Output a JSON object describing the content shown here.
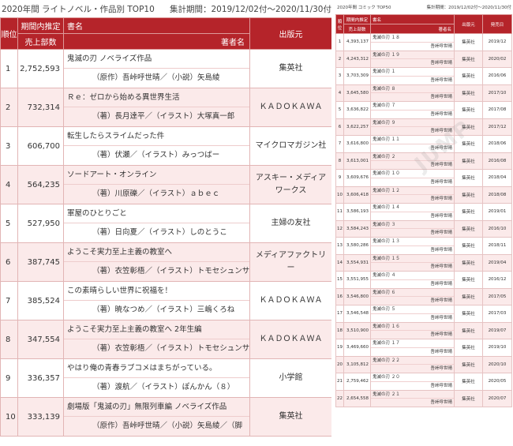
{
  "ln": {
    "title": "2020年間 ライトノベル・作品別 TOP10",
    "period": "集計期間：2019/12/02付〜2020/11/30付",
    "headers": {
      "rank": "順位",
      "sales_1": "期間内推定",
      "sales_2": "売上部数",
      "book": "書名",
      "author": "著者名",
      "publisher": "出版元"
    },
    "rows": [
      {
        "rank": "1",
        "sales": "2,752,593",
        "title": "鬼滅の刃 ノベライズ作品",
        "author": "（原作）吾峠呼世晴／（小説）矢島綾",
        "publisher": "集英社"
      },
      {
        "rank": "2",
        "sales": "732,314",
        "title": "Ｒｅ：ゼロから始める異世界生活",
        "author": "（著）長月達平／（イラスト）大塚真一郎",
        "publisher": "ＫＡＤＯＫＡＷＡ"
      },
      {
        "rank": "3",
        "sales": "606,700",
        "title": "転生したらスライムだった件",
        "author": "（著）伏瀬／（イラスト）みっつばー",
        "publisher": "マイクロマガジン社"
      },
      {
        "rank": "4",
        "sales": "564,235",
        "title": "ソードアート・オンライン",
        "author": "（著）川原礫／（イラスト）ａｂｅｃ",
        "publisher": "アスキー・メディアワークス"
      },
      {
        "rank": "5",
        "sales": "527,950",
        "title": "軍屋のひとりごと",
        "author": "（著）日向夏／（イラスト）しのとうこ",
        "publisher": "主婦の友社"
      },
      {
        "rank": "6",
        "sales": "387,745",
        "title": "ようこそ実力至上主義の教室へ",
        "author": "（著）衣笠彰梧／（イラスト）トモセシュンサク",
        "publisher": "メディアファクトリー"
      },
      {
        "rank": "7",
        "sales": "385,524",
        "title": "この素晴らしい世界に祝福を！",
        "author": "（著）暁なつめ／（イラスト）三嶋くろね",
        "publisher": "ＫＡＤＯＫＡＷＡ"
      },
      {
        "rank": "8",
        "sales": "347,554",
        "title": "ようこそ実力至上主義の教室へ 2年生編",
        "author": "（著）衣笠彰梧／（イラスト）トモセシュンサク",
        "publisher": "ＫＡＤＯＫＡＷＡ"
      },
      {
        "rank": "9",
        "sales": "336,357",
        "title": "やはり俺の青春ラブコメはまちがっている。",
        "author": "（著）渡航／（イラスト）ぽんかん（８）",
        "publisher": "小学館"
      },
      {
        "rank": "10",
        "sales": "333,139",
        "title": "劇場版「鬼滅の刃」無限列車編 ノベライズ作品",
        "author": "（原作）吾峠呼世晴／（小説）矢島綾／（脚",
        "publisher": "集英社"
      }
    ]
  },
  "comic": {
    "title": "2020年間 コミック TOP50",
    "period": "集計期間：2019/12/02付〜2020/11/30付",
    "headers": {
      "rank": "順位",
      "sales_1": "期間内推定",
      "sales_2": "売上部数",
      "book": "書名",
      "author": "著者名",
      "publisher": "出版元",
      "date": "発売日"
    },
    "rows": [
      {
        "rank": "1",
        "sales": "4,393,137",
        "title": "鬼滅の刃 １８",
        "author": "吾峠呼世晴",
        "publisher": "集英社",
        "date": "2019/12"
      },
      {
        "rank": "2",
        "sales": "4,243,312",
        "title": "鬼滅の刃 １９",
        "author": "吾峠呼世晴",
        "publisher": "集英社",
        "date": "2020/02"
      },
      {
        "rank": "3",
        "sales": "3,703,309",
        "title": "鬼滅の刃 １",
        "author": "吾峠呼世晴",
        "publisher": "集英社",
        "date": "2016/06"
      },
      {
        "rank": "4",
        "sales": "3,645,580",
        "title": "鬼滅の刃 ８",
        "author": "吾峠呼世晴",
        "publisher": "集英社",
        "date": "2017/10"
      },
      {
        "rank": "5",
        "sales": "3,636,822",
        "title": "鬼滅の刃 ７",
        "author": "吾峠呼世晴",
        "publisher": "集英社",
        "date": "2017/08"
      },
      {
        "rank": "6",
        "sales": "3,622,257",
        "title": "鬼滅の刃 ９",
        "author": "吾峠呼世晴",
        "publisher": "集英社",
        "date": "2017/12"
      },
      {
        "rank": "7",
        "sales": "3,616,800",
        "title": "鬼滅の刃 １１",
        "author": "吾峠呼世晴",
        "publisher": "集英社",
        "date": "2018/06"
      },
      {
        "rank": "8",
        "sales": "3,613,001",
        "title": "鬼滅の刃 ２",
        "author": "吾峠呼世晴",
        "publisher": "集英社",
        "date": "2016/08"
      },
      {
        "rank": "9",
        "sales": "3,609,676",
        "title": "鬼滅の刃 １０",
        "author": "吾峠呼世晴",
        "publisher": "集英社",
        "date": "2018/04"
      },
      {
        "rank": "10",
        "sales": "3,606,418",
        "title": "鬼滅の刃 １２",
        "author": "吾峠呼世晴",
        "publisher": "集英社",
        "date": "2018/08"
      },
      {
        "rank": "11",
        "sales": "3,586,193",
        "title": "鬼滅の刃 １４",
        "author": "吾峠呼世晴",
        "publisher": "集英社",
        "date": "2019/01"
      },
      {
        "rank": "12",
        "sales": "3,584,243",
        "title": "鬼滅の刃 ３",
        "author": "吾峠呼世晴",
        "publisher": "集英社",
        "date": "2016/10"
      },
      {
        "rank": "13",
        "sales": "3,580,286",
        "title": "鬼滅の刃 １３",
        "author": "吾峠呼世晴",
        "publisher": "集英社",
        "date": "2018/11"
      },
      {
        "rank": "14",
        "sales": "3,554,931",
        "title": "鬼滅の刃 １５",
        "author": "吾峠呼世晴",
        "publisher": "集英社",
        "date": "2019/04"
      },
      {
        "rank": "15",
        "sales": "3,551,955",
        "title": "鬼滅の刃 ４",
        "author": "吾峠呼世晴",
        "publisher": "集英社",
        "date": "2016/12"
      },
      {
        "rank": "16",
        "sales": "3,546,800",
        "title": "鬼滅の刃 ６",
        "author": "吾峠呼世晴",
        "publisher": "集英社",
        "date": "2017/05"
      },
      {
        "rank": "17",
        "sales": "3,546,548",
        "title": "鬼滅の刃 ５",
        "author": "吾峠呼世晴",
        "publisher": "集英社",
        "date": "2017/03"
      },
      {
        "rank": "18",
        "sales": "3,510,900",
        "title": "鬼滅の刃 １６",
        "author": "吾峠呼世晴",
        "publisher": "集英社",
        "date": "2019/07"
      },
      {
        "rank": "19",
        "sales": "3,469,660",
        "title": "鬼滅の刃 １７",
        "author": "吾峠呼世晴",
        "publisher": "集英社",
        "date": "2019/10"
      },
      {
        "rank": "20",
        "sales": "3,105,812",
        "title": "鬼滅の刃 ２２",
        "author": "吾峠呼世晴",
        "publisher": "集英社",
        "date": "2020/10"
      },
      {
        "rank": "21",
        "sales": "2,759,462",
        "title": "鬼滅の刃 ２０",
        "author": "吾峠呼世晴",
        "publisher": "集英社",
        "date": "2020/05"
      },
      {
        "rank": "22",
        "sales": "2,654,558",
        "title": "鬼滅の刃 ２１",
        "author": "吾峠呼世晴",
        "publisher": "集英社",
        "date": "2020/07"
      }
    ]
  },
  "watermark": "JUMP"
}
